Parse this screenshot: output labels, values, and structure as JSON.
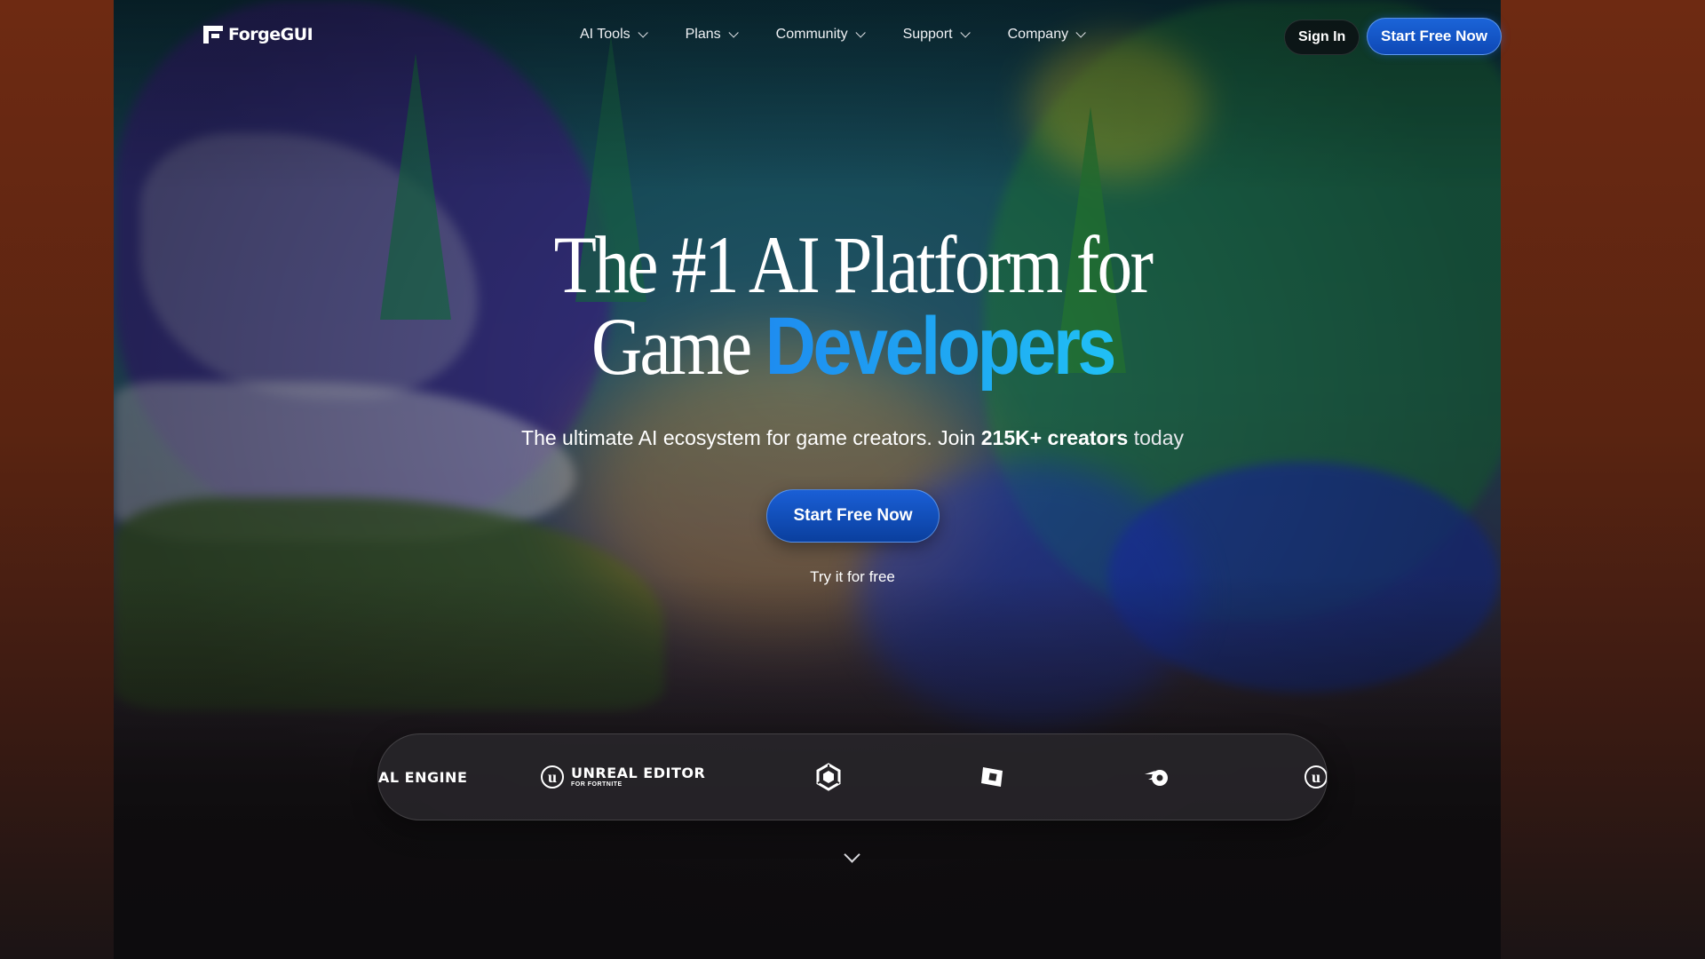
{
  "brand": {
    "name": "ForgeGUI"
  },
  "nav": {
    "items": [
      {
        "label": "AI Tools"
      },
      {
        "label": "Plans"
      },
      {
        "label": "Community"
      },
      {
        "label": "Support"
      },
      {
        "label": "Company"
      }
    ],
    "sign_in": "Sign In",
    "start_free": "Start Free Now"
  },
  "hero": {
    "title_line1": "The #1 AI Platform for",
    "title_line2_plain": "Game",
    "title_line2_accent": "Developers",
    "subtitle_part1": "The ultimate AI ecosystem for game creators. Join",
    "subtitle_bold": "215K+ creators",
    "subtitle_part2": "today",
    "cta_label": "Start Free Now",
    "cta_note": "Try it for free"
  },
  "integrations": {
    "items": [
      {
        "label": "AL ENGINE",
        "icon": "unreal-engine-wordmark"
      },
      {
        "label": "UNREAL EDITOR",
        "sublabel": "FOR FORTNITE",
        "icon": "unreal-logo-icon"
      },
      {
        "icon": "unity-logo-icon"
      },
      {
        "icon": "roblox-logo-icon"
      },
      {
        "icon": "blender-logo-icon"
      },
      {
        "icon": "unreal-logo-icon"
      }
    ]
  },
  "colors": {
    "accent_blue": "#1e8cf0",
    "accent_cyan": "#20c0f5",
    "button_blue": "#1b64d8",
    "background": "#141215"
  }
}
